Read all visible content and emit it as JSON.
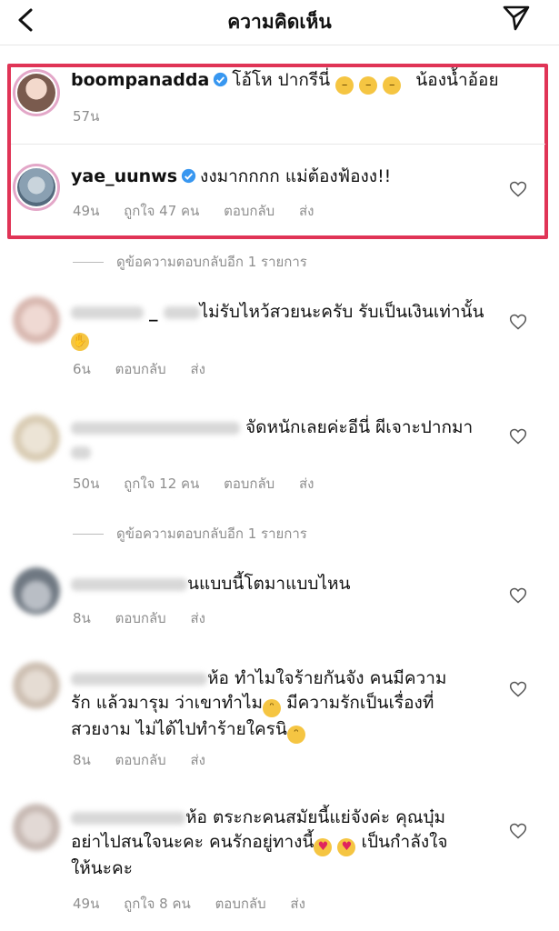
{
  "header": {
    "title": "ความคิดเห็น"
  },
  "comments": [
    {
      "username": "boompanadda",
      "text": "โอ้โห ปากรีนี่",
      "text_after": "น้องน้ำอ้อย",
      "time": "57น"
    },
    {
      "username": "yae_uunws",
      "text": "งงมากกกก แม่ต้องฟ้องง!!",
      "time": "49น",
      "likes": "ถูกใจ 47 คน",
      "reply": "ตอบกลับ",
      "send": "ส่ง"
    },
    {
      "text": "ไม่รับไหว้สวยนะครับ รับเป็นเงินเท่านั้น",
      "username_suffix": "_",
      "time": "6น",
      "reply": "ตอบกลับ",
      "send": "ส่ง"
    },
    {
      "text": "จัดหนักเลยค่ะอีนี่ ผีเจาะปากมา",
      "time": "50น",
      "likes": "ถูกใจ 12 คน",
      "reply": "ตอบกลับ",
      "send": "ส่ง"
    },
    {
      "text": "นแบบนี้โตมาแบบไหน",
      "time": "8น",
      "reply": "ตอบกลับ",
      "send": "ส่ง"
    },
    {
      "text1": "ห้อ ทำไมใจร้ายกันจัง คนมีความ",
      "text2": "รัก แล้วมารุม ว่าเขาทำไม",
      "text2b": "มีความรักเป็นเรื่องที่",
      "text3": "สวยงาม ไม่ได้ไปทำร้ายใครนิ",
      "time": "8น",
      "reply": "ตอบกลับ",
      "send": "ส่ง"
    },
    {
      "text1": "ห้อ ตระกะคนสมัยนี้แย่จังค่ะ คุณบุ๋ม",
      "text2": "อย่าไปสนใจนะคะ  คนรักอยู่ทางนี้",
      "text2b": "เป็นกำลังใจ",
      "text3": "ให้นะคะ",
      "time": "49น",
      "likes": "ถูกใจ 8 คน",
      "reply": "ตอบกลับ",
      "send": "ส่ง"
    }
  ],
  "view_replies": "ดูข้อความตอบกลับอีก 1 รายการ",
  "colors": {
    "highlight": "#e03456",
    "verified": "#3897f0",
    "meta": "#8e8e8e"
  }
}
